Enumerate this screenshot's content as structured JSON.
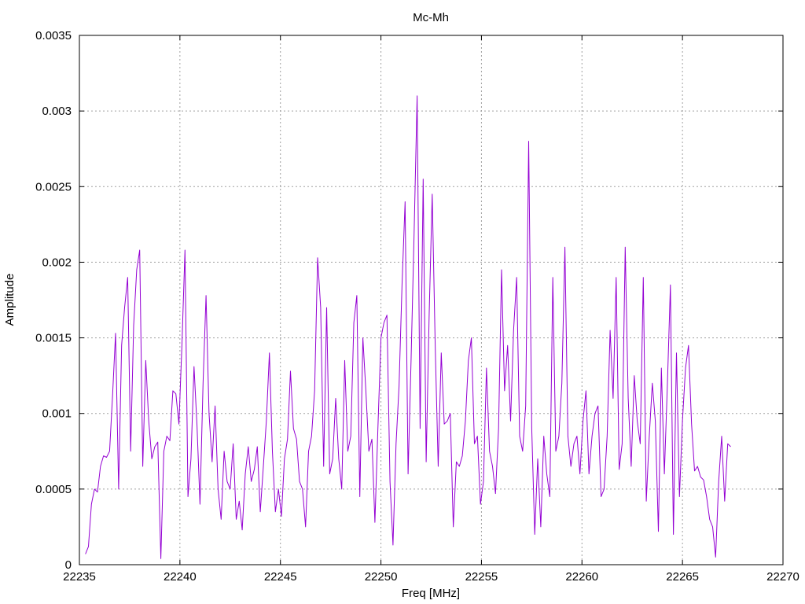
{
  "chart_data": {
    "type": "line",
    "title": "Mc-Mh",
    "xlabel": "Freq [MHz]",
    "ylabel": "Amplitude",
    "xlim": [
      22235,
      22270
    ],
    "ylim": [
      0,
      0.0035
    ],
    "xticks": [
      22235,
      22240,
      22245,
      22250,
      22255,
      22260,
      22265,
      22270
    ],
    "xtick_labels": [
      "22235",
      "22240",
      "22245",
      "22250",
      "22255",
      "22260",
      "22265",
      "22270"
    ],
    "yticks": [
      0,
      0.0005,
      0.001,
      0.0015,
      0.002,
      0.0025,
      0.003,
      0.0035
    ],
    "ytick_labels": [
      "0",
      "0.0005",
      "0.001",
      "0.0015",
      "0.002",
      "0.0025",
      "0.003",
      "0.0035"
    ],
    "grid": true,
    "series": [
      {
        "color": "#9400d3",
        "x": [
          22235.3,
          22235.45,
          22235.6,
          22235.75,
          22235.9,
          22236.05,
          22236.2,
          22236.35,
          22236.5,
          22236.65,
          22236.8,
          22236.95,
          22237.1,
          22237.25,
          22237.4,
          22237.55,
          22237.7,
          22237.85,
          22238.0,
          22238.15,
          22238.3,
          22238.45,
          22238.6,
          22238.75,
          22238.9,
          22239.05,
          22239.2,
          22239.35,
          22239.5,
          22239.65,
          22239.8,
          22239.95,
          22240.1,
          22240.25,
          22240.4,
          22240.55,
          22240.7,
          22240.85,
          22241.0,
          22241.15,
          22241.3,
          22241.45,
          22241.6,
          22241.75,
          22241.9,
          22242.05,
          22242.2,
          22242.35,
          22242.5,
          22242.65,
          22242.8,
          22242.95,
          22243.1,
          22243.25,
          22243.4,
          22243.55,
          22243.7,
          22243.85,
          22244.0,
          22244.15,
          22244.3,
          22244.45,
          22244.6,
          22244.75,
          22244.9,
          22245.05,
          22245.2,
          22245.35,
          22245.5,
          22245.65,
          22245.8,
          22245.95,
          22246.1,
          22246.25,
          22246.4,
          22246.55,
          22246.7,
          22246.85,
          22247.0,
          22247.15,
          22247.3,
          22247.45,
          22247.6,
          22247.75,
          22247.9,
          22248.05,
          22248.2,
          22248.35,
          22248.5,
          22248.65,
          22248.8,
          22248.95,
          22249.1,
          22249.25,
          22249.4,
          22249.55,
          22249.7,
          22249.85,
          22250.0,
          22250.15,
          22250.3,
          22250.45,
          22250.6,
          22250.75,
          22250.9,
          22251.05,
          22251.2,
          22251.35,
          22251.5,
          22251.65,
          22251.8,
          22251.95,
          22252.1,
          22252.25,
          22252.4,
          22252.55,
          22252.7,
          22252.85,
          22253.0,
          22253.15,
          22253.3,
          22253.45,
          22253.6,
          22253.75,
          22253.9,
          22254.05,
          22254.2,
          22254.35,
          22254.5,
          22254.65,
          22254.8,
          22254.95,
          22255.1,
          22255.25,
          22255.4,
          22255.55,
          22255.7,
          22255.85,
          22256.0,
          22256.15,
          22256.3,
          22256.45,
          22256.6,
          22256.75,
          22256.9,
          22257.05,
          22257.2,
          22257.35,
          22257.5,
          22257.65,
          22257.8,
          22257.95,
          22258.1,
          22258.25,
          22258.4,
          22258.55,
          22258.7,
          22258.85,
          22259.0,
          22259.15,
          22259.3,
          22259.45,
          22259.6,
          22259.75,
          22259.9,
          22260.05,
          22260.2,
          22260.35,
          22260.5,
          22260.65,
          22260.8,
          22260.95,
          22261.1,
          22261.25,
          22261.4,
          22261.55,
          22261.7,
          22261.85,
          22262.0,
          22262.15,
          22262.3,
          22262.45,
          22262.6,
          22262.75,
          22262.9,
          22263.05,
          22263.2,
          22263.35,
          22263.5,
          22263.65,
          22263.8,
          22263.95,
          22264.1,
          22264.25,
          22264.4,
          22264.55,
          22264.7,
          22264.85,
          22265.0,
          22265.15,
          22265.3,
          22265.45,
          22265.6,
          22265.75,
          22265.9,
          22266.05,
          22266.2,
          22266.35,
          22266.5,
          22266.65,
          22266.8,
          22266.95,
          22267.1,
          22267.25,
          22267.4
        ],
        "y": [
          7e-05,
          0.00012,
          0.0004,
          0.0005,
          0.00048,
          0.00065,
          0.00072,
          0.00071,
          0.00075,
          0.00112,
          0.00153,
          0.0005,
          0.00145,
          0.0017,
          0.0019,
          0.00075,
          0.00158,
          0.00195,
          0.00208,
          0.00065,
          0.00135,
          0.00095,
          0.0007,
          0.00078,
          0.00081,
          4e-05,
          0.00075,
          0.00085,
          0.00082,
          0.00115,
          0.00113,
          0.00093,
          0.00145,
          0.00208,
          0.00045,
          0.0007,
          0.00131,
          0.00092,
          0.0004,
          0.0012,
          0.00178,
          0.001,
          0.00068,
          0.00105,
          0.0005,
          0.0003,
          0.00075,
          0.00055,
          0.0005,
          0.0008,
          0.0003,
          0.00042,
          0.00023,
          0.0006,
          0.00078,
          0.00055,
          0.00063,
          0.00078,
          0.00035,
          0.00065,
          0.00095,
          0.0014,
          0.00075,
          0.00035,
          0.0005,
          0.00032,
          0.0007,
          0.00083,
          0.00128,
          0.0009,
          0.00083,
          0.00055,
          0.0005,
          0.00025,
          0.00075,
          0.00085,
          0.00115,
          0.00203,
          0.0017,
          0.00065,
          0.0017,
          0.0006,
          0.0007,
          0.0011,
          0.0007,
          0.0005,
          0.00135,
          0.00075,
          0.00085,
          0.0016,
          0.00178,
          0.00045,
          0.0015,
          0.00115,
          0.00075,
          0.00083,
          0.00028,
          0.0009,
          0.0015,
          0.0016,
          0.00165,
          0.00055,
          0.00013,
          0.0008,
          0.00118,
          0.00185,
          0.0024,
          0.0006,
          0.00135,
          0.0022,
          0.0031,
          0.0009,
          0.00255,
          0.00068,
          0.00165,
          0.00245,
          0.00145,
          0.00065,
          0.0014,
          0.00093,
          0.00095,
          0.001,
          0.00025,
          0.00068,
          0.00065,
          0.00072,
          0.00095,
          0.00135,
          0.0015,
          0.0008,
          0.00085,
          0.0004,
          0.00055,
          0.0013,
          0.00075,
          0.00065,
          0.00047,
          0.0009,
          0.00195,
          0.00115,
          0.00145,
          0.00095,
          0.00155,
          0.0019,
          0.00085,
          0.00075,
          0.00105,
          0.0028,
          0.0009,
          0.0002,
          0.0007,
          0.00025,
          0.00085,
          0.0006,
          0.00045,
          0.0019,
          0.00075,
          0.00085,
          0.0012,
          0.0021,
          0.00085,
          0.00065,
          0.0008,
          0.00085,
          0.0006,
          0.00095,
          0.00115,
          0.0006,
          0.00085,
          0.001,
          0.00105,
          0.00045,
          0.0005,
          0.00085,
          0.00155,
          0.0011,
          0.0019,
          0.00063,
          0.0008,
          0.0021,
          0.0011,
          0.00065,
          0.00125,
          0.00095,
          0.0008,
          0.0019,
          0.00042,
          0.00085,
          0.0012,
          0.00095,
          0.00022,
          0.0013,
          0.0006,
          0.0012,
          0.00185,
          0.0002,
          0.0014,
          0.00045,
          0.00095,
          0.0013,
          0.00145,
          0.00093,
          0.00062,
          0.00065,
          0.00058,
          0.00056,
          0.00045,
          0.0003,
          0.00025,
          5e-05,
          0.00055,
          0.00085,
          0.00042,
          0.0008,
          0.00078
        ]
      }
    ]
  }
}
